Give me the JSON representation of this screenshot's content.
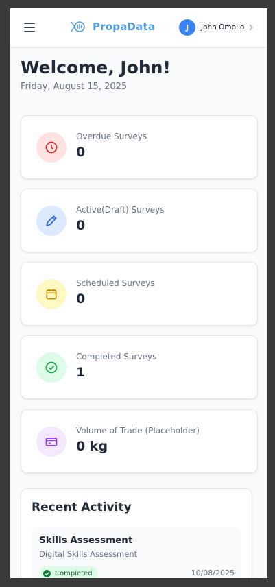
{
  "header": {
    "app_name": "PropaData",
    "user": {
      "initial": "J",
      "name": "John Omollo"
    }
  },
  "welcome": {
    "title": "Welcome, John!",
    "date": "Friday, August 15, 2025"
  },
  "stats": [
    {
      "label": "Overdue Surveys",
      "value": "0",
      "icon": "clock-icon",
      "color": "#dc2626",
      "bg": "#fee2e2"
    },
    {
      "label": "Active(Draft) Surveys",
      "value": "0",
      "icon": "pencil-icon",
      "color": "#2563eb",
      "bg": "#dbeafe"
    },
    {
      "label": "Scheduled Surveys",
      "value": "0",
      "icon": "calendar-icon",
      "color": "#ca8a04",
      "bg": "#fef9c3"
    },
    {
      "label": "Completed Surveys",
      "value": "1",
      "icon": "check-circle-icon",
      "color": "#16a34a",
      "bg": "#dcfce7"
    },
    {
      "label": "Volume of Trade (Placeholder)",
      "value": "0 kg",
      "icon": "credit-card-icon",
      "color": "#9333ea",
      "bg": "#f3e8ff"
    }
  ],
  "recent_activity": {
    "title": "Recent Activity",
    "items": [
      {
        "title": "Skills Assessment",
        "subtitle": "Digital Skills Assessment",
        "status": "Completed",
        "date": "10/08/2025"
      }
    ]
  }
}
